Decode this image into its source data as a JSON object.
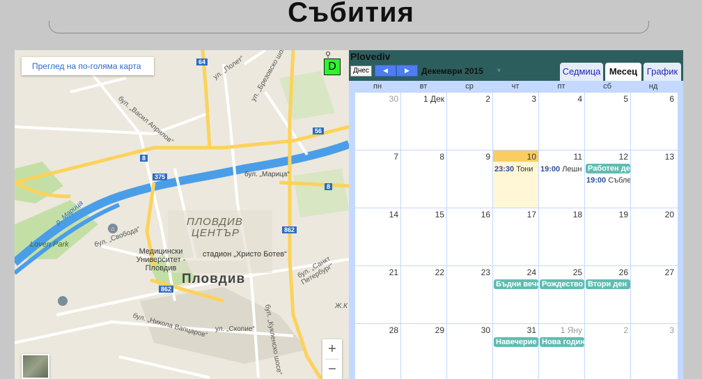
{
  "page": {
    "title": "Събития"
  },
  "map": {
    "larger_map_link": "Преглед на по-голяма карта",
    "marker_label": "D",
    "zoom_in": "+",
    "zoom_out": "−",
    "labels": {
      "center_top": "ПЛОВДИВ",
      "center_bottom": "ЦЕНТЪР",
      "city": "Пловдив",
      "river_maritsa": "бул. „Марица“",
      "river_name": "р. Марица",
      "loven_park": "Loven Park",
      "bul_vasil": "бул. „Васил Априлов“",
      "ul_polet": "ул. „Полет“",
      "ul_brezovsko": "ул. „Брезовско шосе“",
      "bul_svoboda": "бул. „Свобода“",
      "university": "Медицински Университет - Пловдив",
      "stadium": "стадион „Христо Ботев“",
      "bul_nikola": "бул. „Никола Вапцаров“",
      "ul_skopie": "ул. „Скопие“",
      "kuklensko": "бул. „Кукленско шосе“",
      "sankt_peter": "бул. „Санкт Петербург“",
      "zhk": "Ж.К",
      "route_64": "64",
      "route_56": "56",
      "route_8a": "8",
      "route_375": "375",
      "route_8b": "8",
      "route_862a": "862",
      "route_862b": "862"
    },
    "colors": {
      "land": "#ece8dd",
      "water": "#4a9ee8",
      "park": "#c4dfa6",
      "highway": "#fcd25a",
      "road": "#ffffff"
    }
  },
  "calendar": {
    "name": "Plovediv",
    "today_label": "Днес",
    "month_label": "Декември 2015",
    "tabs": [
      {
        "label": "Седмица",
        "active": false
      },
      {
        "label": "Месец",
        "active": true
      },
      {
        "label": "График",
        "active": false
      }
    ],
    "days_of_week": [
      "пн",
      "вт",
      "ср",
      "чт",
      "пт",
      "сб",
      "нд"
    ],
    "weeks": [
      [
        "30",
        "1 Дек",
        "2",
        "3",
        "4",
        "5",
        "6"
      ],
      [
        "7",
        "8",
        "9",
        "10",
        "11",
        "12",
        "13"
      ],
      [
        "14",
        "15",
        "16",
        "17",
        "18",
        "19",
        "20"
      ],
      [
        "21",
        "22",
        "23",
        "24",
        "25",
        "26",
        "27"
      ],
      [
        "28",
        "29",
        "30",
        "31",
        "1 Яну",
        "2",
        "3"
      ]
    ],
    "events": {
      "thu_10_time": "23:30",
      "thu_10_title": "Тони",
      "fri_11_time": "19:00",
      "fri_11_title": "Лешн",
      "sat_12_bar": "Работен ден",
      "sat_12_time": "19:00",
      "sat_12_title": "Съблезнание",
      "thu_24_bar": "Бъдни вечер",
      "fri_25_bar": "Рождество",
      "sat_26_bar": "Втори ден",
      "thu_31_bar": "Навечерие",
      "fri_1_bar": "Нова година"
    },
    "colors": {
      "header": "#2d5e5e",
      "event": "#5fbdb0",
      "today": "#fff7d6",
      "grid": "#c3d9ff"
    }
  }
}
